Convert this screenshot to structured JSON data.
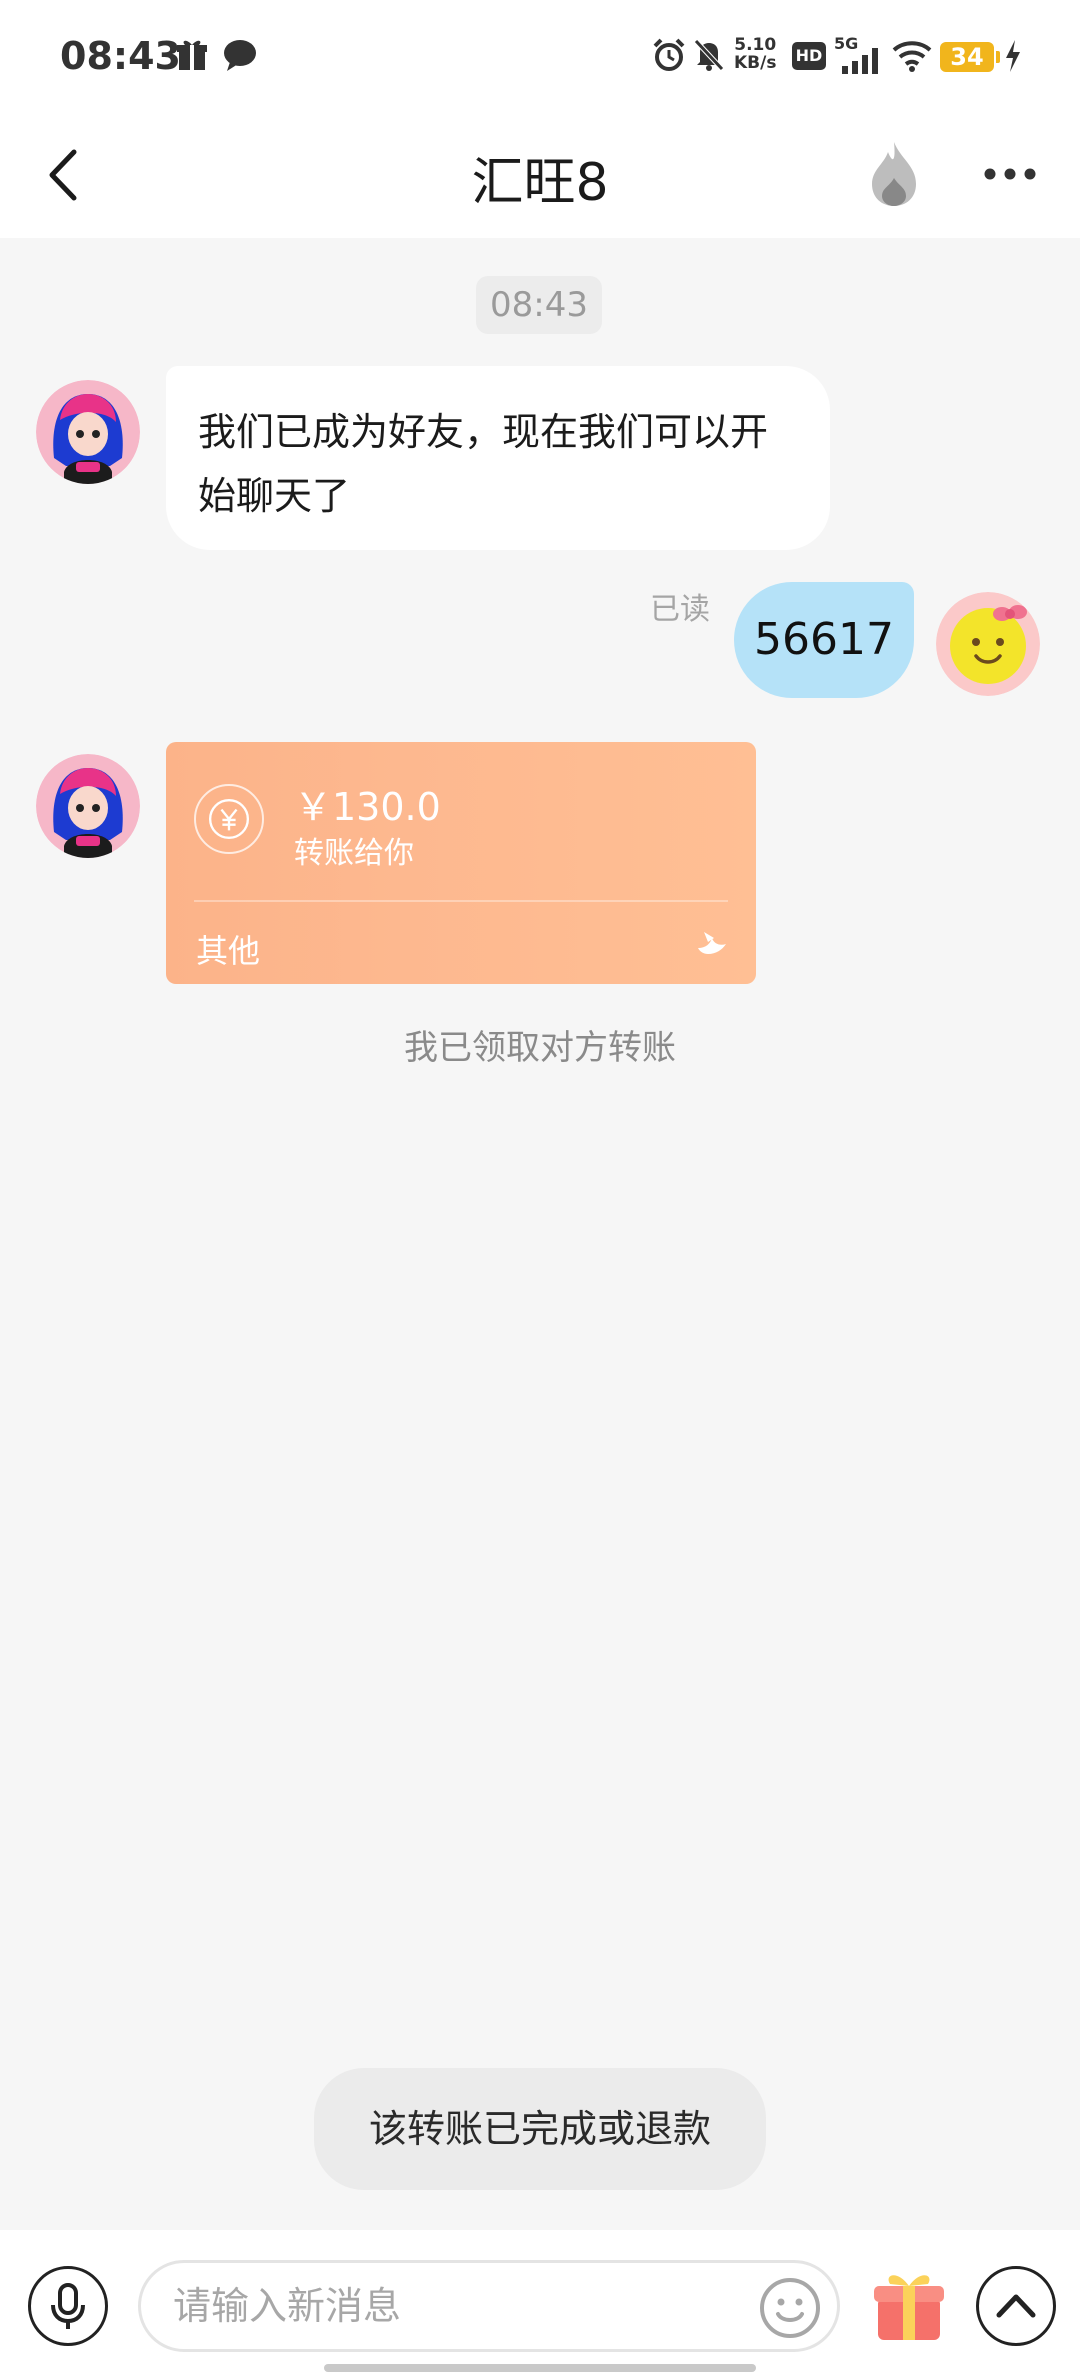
{
  "status_bar": {
    "time": "08:43",
    "net_speed_value": "5.10",
    "net_speed_unit": "KB/s",
    "hd_label": "HD",
    "network_label": "5G",
    "battery_level": "34",
    "icons": [
      "gift-icon",
      "chat-bubble-icon",
      "alarm-icon",
      "mute-icon",
      "hd-icon",
      "signal-icon",
      "wifi-icon",
      "battery-icon",
      "charging-icon"
    ]
  },
  "header": {
    "title": "汇旺8",
    "back_icon": "back-arrow-icon",
    "flame_icon": "flame-icon",
    "more_icon": "more-icon"
  },
  "chat": {
    "timestamp": "08:43",
    "messages": [
      {
        "side": "left",
        "type": "text",
        "text": "我们已成为好友，现在我们可以开始聊天了"
      },
      {
        "side": "right",
        "type": "text",
        "text": "56617",
        "status": "已读"
      },
      {
        "side": "left",
        "type": "transfer",
        "amount": "￥130.0",
        "description": "转账给你",
        "footer": "其他"
      }
    ],
    "system_note": "我已领取对方转账"
  },
  "toast": "该转账已完成或退款",
  "input_bar": {
    "placeholder": "请输入新消息",
    "value": ""
  },
  "colors": {
    "bubble_right": "#b5e2f8",
    "transfer_card": "#fdb88f",
    "chat_background": "#f6f6f6"
  }
}
